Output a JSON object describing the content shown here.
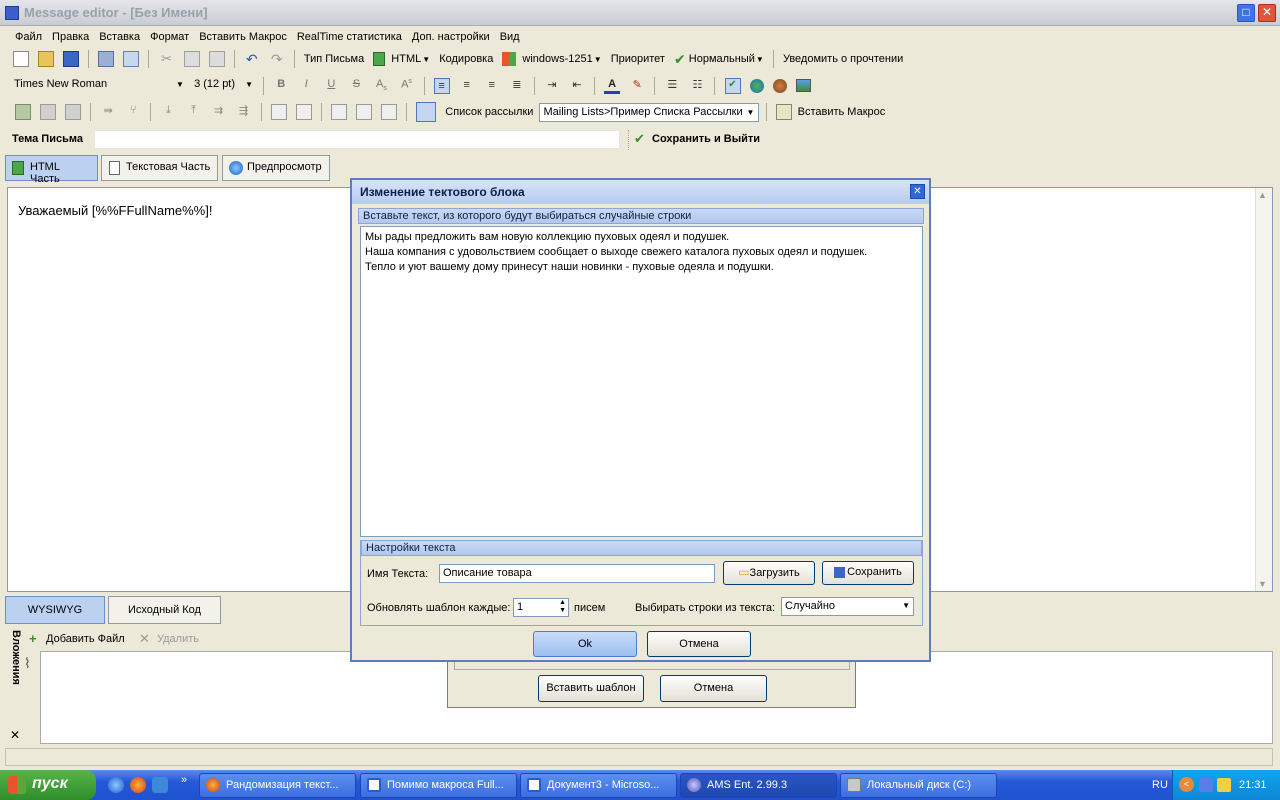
{
  "window": {
    "title": "Message editor - [Без Имени]"
  },
  "menu": [
    "Файл",
    "Правка",
    "Вставка",
    "Формат",
    "Вставить Макрос",
    "RealTime статистика",
    "Доп. настройки",
    "Вид"
  ],
  "toolbar1": {
    "letter_type": "Тип Письма",
    "html": "HTML",
    "encoding_label": "Кодировка",
    "encoding_value": "windows-1251",
    "priority_label": "Приоритет",
    "priority_value": "Нормальный",
    "notify": "Уведомить о прочтении"
  },
  "toolbar2": {
    "font": "Times New Roman",
    "size": "3  (12 pt)"
  },
  "toolbar3": {
    "mailing_label": "Список рассылки",
    "mailing_value": "Mailing Lists>Пример Списка Рассылки",
    "insert_macro": "Вставить Макрос"
  },
  "subject": {
    "label": "Тема Письма",
    "value": "",
    "save_exit": "Сохранить и Выйти"
  },
  "tabs": [
    "HTML Часть",
    "Текстовая Часть",
    "Предпросмотр"
  ],
  "editor_text": "Уважаемый [%%FFullName%%]!",
  "bottom_tabs": [
    "WYSIWYG",
    "Исходный Код"
  ],
  "attachments": {
    "add": "Добавить Файл",
    "delete": "Удалить",
    "side_label": "Вложения"
  },
  "back_dialog": {
    "insert": "Вставить шаблон",
    "cancel": "Отмена"
  },
  "dialog": {
    "title": "Изменение тектового блока",
    "group1": "Вставьте текст, из которого будут выбираться случайные строки",
    "lines": [
      "Мы рады предложить вам новую коллекцию пуховых одеял и подушек.",
      "Наша компания с удовольствием сообщает о выходе свежего каталога пуховых одеял и подушек.",
      "Тепло и уют вашему дому принесут наши новинки - пуховые одеяла и подушки."
    ],
    "group2": "Настройки текста",
    "name_label": "Имя Текста:",
    "name_value": "Описание товара",
    "load": "Загрузить",
    "save": "Сохранить",
    "update_label": "Обновлять шаблон каждые:",
    "update_value": "1",
    "update_unit": "писем",
    "select_label": "Выбирать строки из текста:",
    "select_value": "Случайно",
    "ok": "Ok",
    "cancel": "Отмена"
  },
  "taskbar": {
    "start": "пуск",
    "tasks": [
      "Рандомизация текст...",
      "Помимо макроса Full...",
      "Документ3 - Microso...",
      "AMS Ent. 2.99.3",
      "Локальный диск (C:)"
    ],
    "lang": "RU",
    "time": "21:31"
  }
}
